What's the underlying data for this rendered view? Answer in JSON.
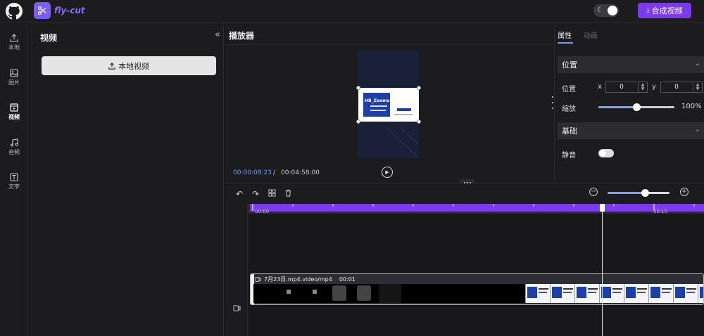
{
  "app": {
    "name": "fly-cut"
  },
  "topbar": {
    "export_label": "合成视频"
  },
  "nav": {
    "items": [
      {
        "label": "本地",
        "icon": "upload-icon"
      },
      {
        "label": "图片",
        "icon": "image-icon"
      },
      {
        "label": "视频",
        "icon": "video-icon",
        "active": true
      },
      {
        "label": "音频",
        "icon": "music-icon"
      },
      {
        "label": "文字",
        "icon": "text-icon"
      }
    ]
  },
  "library": {
    "title": "视频",
    "local_button": "本地视频"
  },
  "player": {
    "title": "播放器",
    "current_time": "00:00:08:23",
    "separator": "/",
    "total_time": "00:04:58:00",
    "preview_heading": "HB_Zooms 项目"
  },
  "props": {
    "tabs": {
      "attributes": "属性",
      "animation": "动画"
    },
    "position_section": "位置",
    "position_label": "位置",
    "x_label": "x",
    "x_value": "0",
    "y_label": "y",
    "y_value": "0",
    "scale_label": "缩放",
    "scale_value": "100%",
    "scale_fraction": 0.5,
    "basic_section": "基础",
    "mute_label": "静音"
  },
  "timeline": {
    "ruler": {
      "start": "00:00",
      "tick": "00:10"
    },
    "zoom_fraction": 0.6,
    "clip": {
      "name": "7月23日.mp4.video/mp4",
      "duration": "00:01"
    }
  },
  "colors": {
    "accent": "#7c3aed",
    "highlight": "#6aa0ff",
    "background": "#1c1c1f"
  }
}
